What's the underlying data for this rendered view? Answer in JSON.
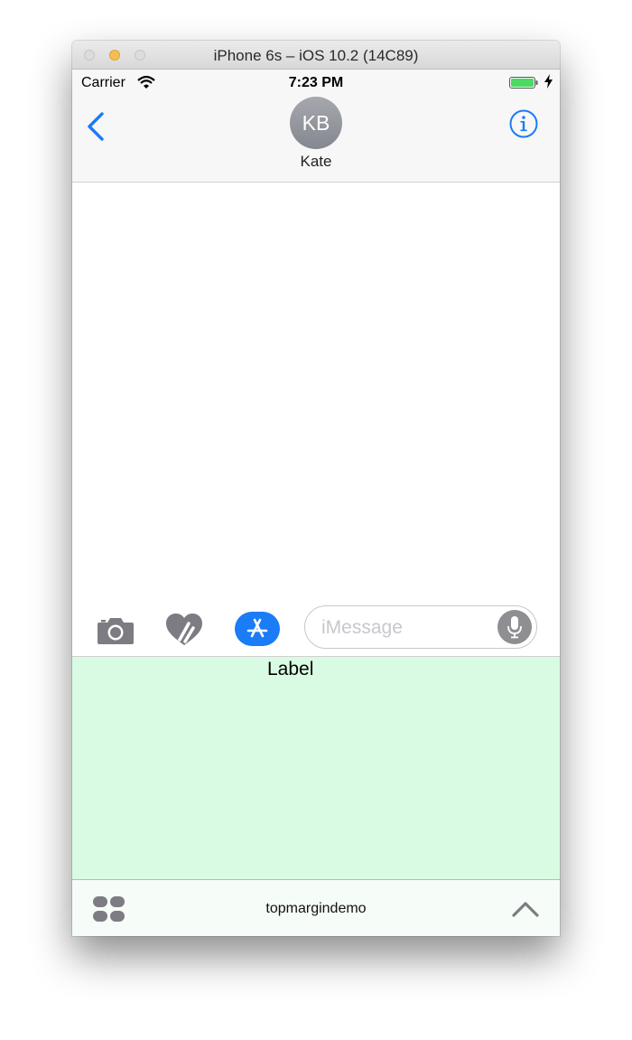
{
  "window": {
    "title": "iPhone 6s – iOS 10.2 (14C89)"
  },
  "status_bar": {
    "carrier": "Carrier",
    "time": "7:23 PM",
    "battery_color": "#4cd964"
  },
  "nav": {
    "avatar_initials": "KB",
    "contact_name": "Kate",
    "accent": "#1a7cf6"
  },
  "composer": {
    "placeholder": "iMessage"
  },
  "extension": {
    "label": "Label",
    "background": "#dafbe3"
  },
  "app_drawer": {
    "title": "topmargindemo"
  },
  "icons": [
    "wifi-icon",
    "battery-icon",
    "charging-bolt-icon",
    "back-chevron-icon",
    "info-icon",
    "camera-icon",
    "digital-touch-heart-icon",
    "app-store-icon",
    "microphone-icon",
    "app-drawer-grid-icon",
    "chevron-up-icon"
  ]
}
